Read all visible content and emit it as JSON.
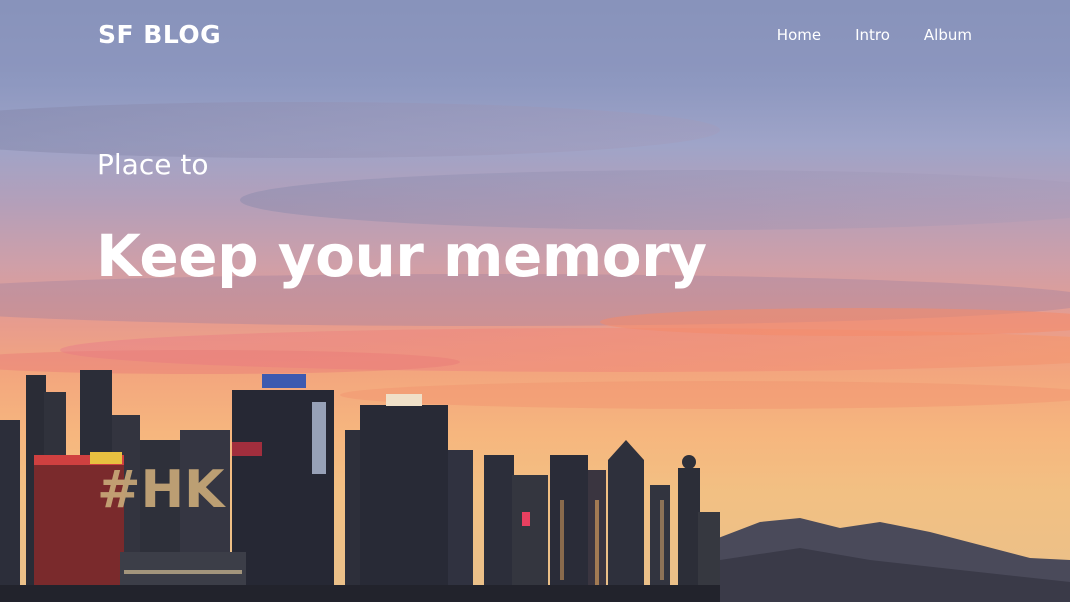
{
  "navbar": {
    "brand": "SF BLOG",
    "links": [
      {
        "label": "Home"
      },
      {
        "label": "Intro"
      },
      {
        "label": "Album"
      }
    ]
  },
  "hero": {
    "subtitle": "Place to",
    "headline": "Keep your memory",
    "hashtag": "#HK"
  },
  "colors": {
    "hashtag": "#c8a878",
    "text": "#ffffff",
    "navbar_bg": "rgba(140,150,190,0.55)"
  }
}
